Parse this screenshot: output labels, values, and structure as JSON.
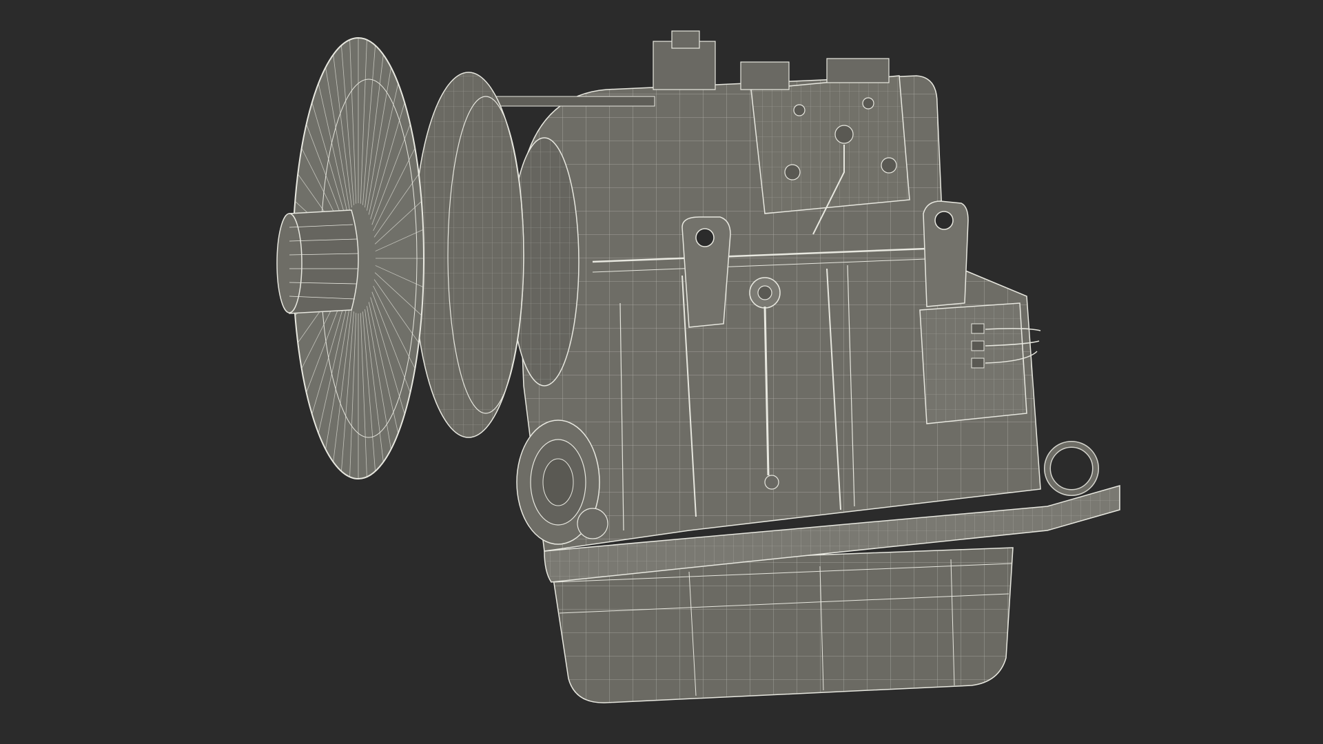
{
  "scene": {
    "subject": "marine-gearbox-wireframe-render",
    "background_color": "#2b2b2b",
    "body_color": "#6e6d66",
    "body_shade_color": "#5c5b55",
    "body_dark_color": "#4a4945",
    "wire_color": "#e8e8e0"
  }
}
